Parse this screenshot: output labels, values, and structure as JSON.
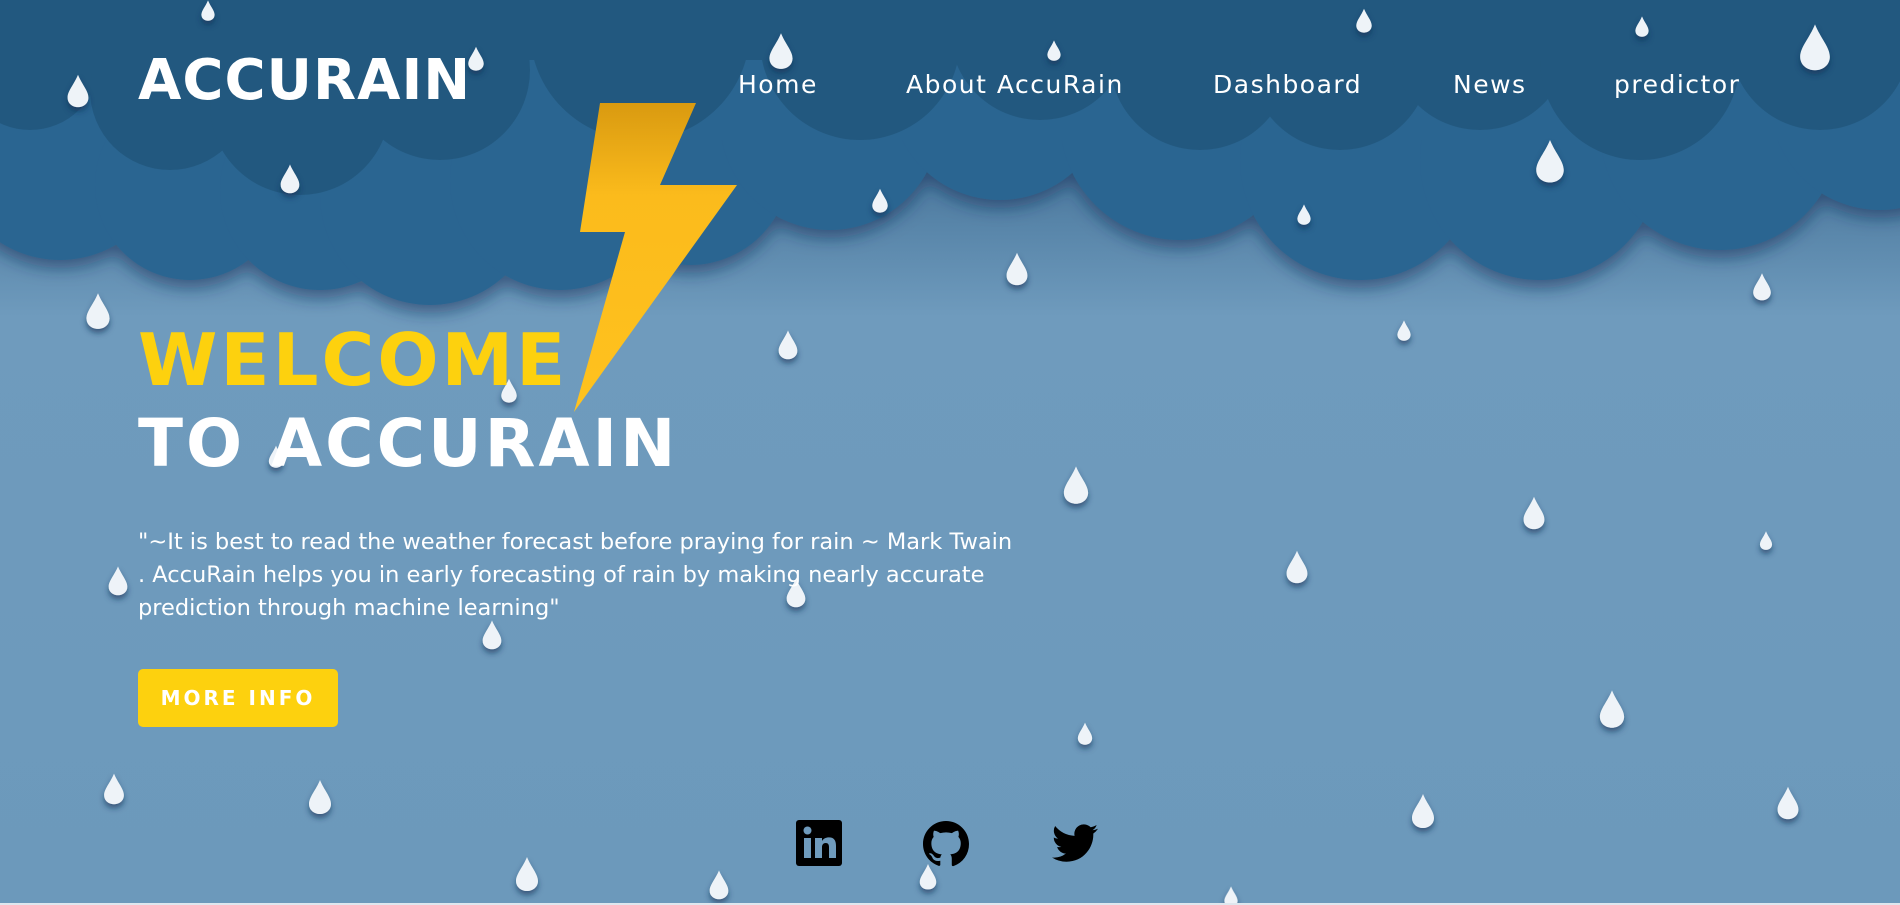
{
  "brand": {
    "name": "ACCURAIN"
  },
  "nav": {
    "items": [
      {
        "label": "Home"
      },
      {
        "label": "About AccuRain"
      },
      {
        "label": "Dashboard"
      },
      {
        "label": "News"
      },
      {
        "label": "predictor"
      }
    ]
  },
  "hero": {
    "welcome": "WELCOME",
    "subtitle": "TO ACCURAIN",
    "quote": "\"~It is best to read the weather forecast before praying for rain ~ Mark Twain . AccuRain helps you in early forecasting of rain by making nearly accurate prediction through machine learning\"",
    "button_label": "MORE INFO"
  },
  "social": [
    {
      "icon": "linkedin-icon"
    },
    {
      "icon": "github-icon"
    },
    {
      "icon": "twitter-icon"
    }
  ],
  "colors": {
    "sky": "#6f9bbd",
    "cloud": "#245a84",
    "accent_yellow": "#fdd10e",
    "raindrop": "#eef3f8",
    "text": "#ffffff"
  }
}
